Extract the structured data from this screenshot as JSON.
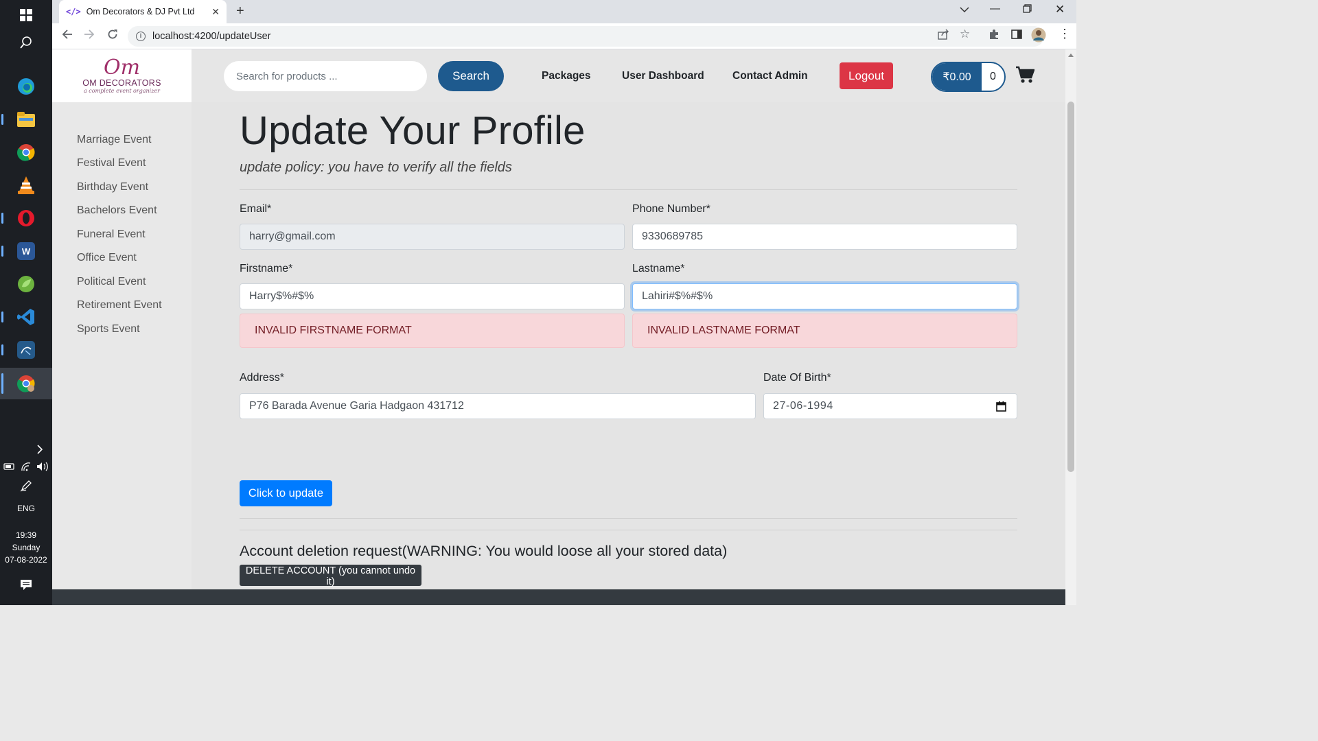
{
  "taskbar": {
    "language": "ENG",
    "time": "19:39",
    "day": "Sunday",
    "date": "07-08-2022"
  },
  "browser": {
    "tab_title": "Om Decorators & DJ Pvt Ltd",
    "tab_favicon": "</>",
    "url": "localhost:4200/updateUser"
  },
  "navbar": {
    "logo_mark": "Om",
    "logo_name": "OM DECORATORS",
    "logo_tagline": "a complete event organizer",
    "search_placeholder": "Search for products ...",
    "search_label": "Search",
    "links": [
      "Packages",
      "User Dashboard",
      "Contact Admin"
    ],
    "logout_label": "Logout",
    "cart_total": "₹0.00",
    "cart_count": "0"
  },
  "sidebar": {
    "items": [
      "Marriage Event",
      "Festival Event",
      "Birthday Event",
      "Bachelors Event",
      "Funeral Event",
      "Office Event",
      "Political Event",
      "Retirement Event",
      "Sports Event"
    ]
  },
  "form": {
    "title": "Update Your Profile",
    "subtitle": "update policy: you have to verify all the fields",
    "email_label": "Email*",
    "email_value": "harry@gmail.com",
    "phone_label": "Phone Number*",
    "phone_value": "9330689785",
    "firstname_label": "Firstname*",
    "firstname_value": "Harry$%#$%",
    "firstname_error": "INVALID FIRSTNAME FORMAT",
    "lastname_label": "Lastname*",
    "lastname_value": "Lahiri#$%#$%",
    "lastname_error": "INVALID LASTNAME FORMAT",
    "address_label": "Address*",
    "address_value": "P76 Barada Avenue Garia Hadgaon 431712",
    "dob_label": "Date Of Birth*",
    "dob_value": "27-06-1994",
    "update_label": "Click to update"
  },
  "delete": {
    "heading": "Account deletion request(WARNING: You would loose all your stored data)",
    "button_label": "DELETE ACCOUNT (you cannot undo it)"
  },
  "colors": {
    "primary": "#007bff",
    "navy": "#1e5a8e",
    "danger": "#dc3545",
    "alert_bg": "#f8d7da",
    "alert_text": "#721c24",
    "dark": "#343a40"
  }
}
